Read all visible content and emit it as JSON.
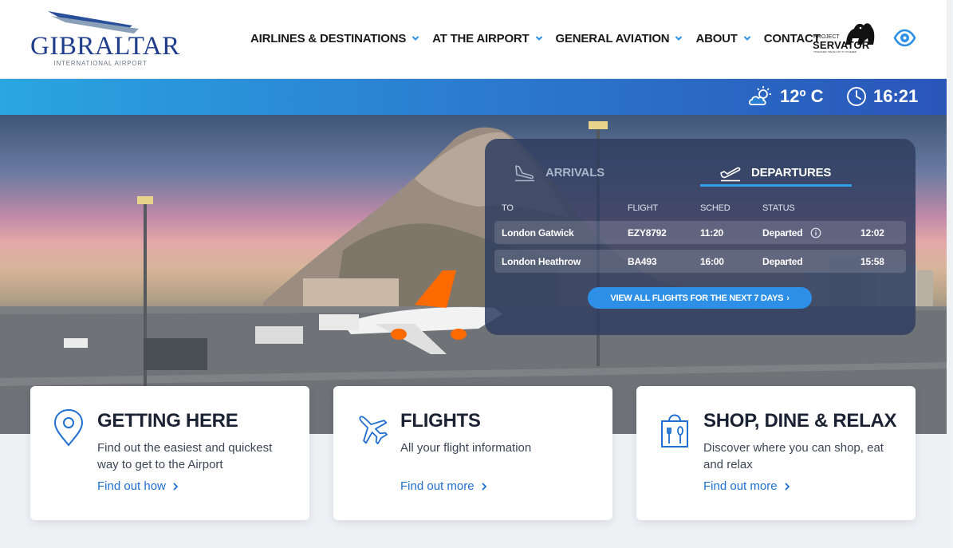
{
  "header": {
    "logo": {
      "name": "GIBRALTAR",
      "subtitle": "INTERNATIONAL AIRPORT",
      "icon": "tail-fin-logo"
    },
    "nav": [
      {
        "label": "AIRLINES & DESTINATIONS",
        "has_dropdown": true
      },
      {
        "label": "AT THE AIRPORT",
        "has_dropdown": true
      },
      {
        "label": "GENERAL AVIATION",
        "has_dropdown": true
      },
      {
        "label": "ABOUT",
        "has_dropdown": true
      },
      {
        "label": "CONTACT",
        "has_dropdown": false
      }
    ],
    "servator": {
      "small": "PROJECT",
      "big": "SERVATOR",
      "tagline": "TOGETHER, WE'VE GOT IT COVERED"
    },
    "accessibility_icon": "eye-icon"
  },
  "infobar": {
    "weather_icon": "partly-cloudy-icon",
    "temperature": "12º C",
    "clock_icon": "clock-icon",
    "time": "16:21"
  },
  "flights": {
    "tabs": [
      {
        "label": "ARRIVALS",
        "icon": "plane-landing-icon",
        "active": false
      },
      {
        "label": "DEPARTURES",
        "icon": "plane-takeoff-icon",
        "active": true
      }
    ],
    "columns": {
      "to": "TO",
      "flight": "FLIGHT",
      "sched": "SCHED",
      "status": "STATUS"
    },
    "rows": [
      {
        "to": "London Gatwick",
        "flight": "EZY8792",
        "sched": "11:20",
        "status": "Departed",
        "actual": "12:02",
        "info": true
      },
      {
        "to": "London Heathrow",
        "flight": "BA493",
        "sched": "16:00",
        "status": "Departed",
        "actual": "15:58",
        "info": false
      }
    ],
    "view_all_label": "VIEW ALL FLIGHTS FOR THE NEXT 7 DAYS",
    "view_all_arrow": "›"
  },
  "cards": [
    {
      "title": "GETTING HERE",
      "desc": "Find out the easiest and quickest way to get to the Airport",
      "link": "Find out how",
      "icon": "map-pin-icon"
    },
    {
      "title": "FLIGHTS",
      "desc": "All your flight information",
      "link": "Find out more",
      "icon": "airplane-icon"
    },
    {
      "title": "SHOP, DINE & RELAX",
      "desc": "Discover where you can shop, eat and relax",
      "link": "Find out more",
      "icon": "shop-dine-icon"
    }
  ],
  "colors": {
    "brand_blue": "#1f3d8a",
    "accent_blue": "#2d8fe6",
    "link_blue": "#1f6fd0",
    "panel": "#303e60"
  }
}
